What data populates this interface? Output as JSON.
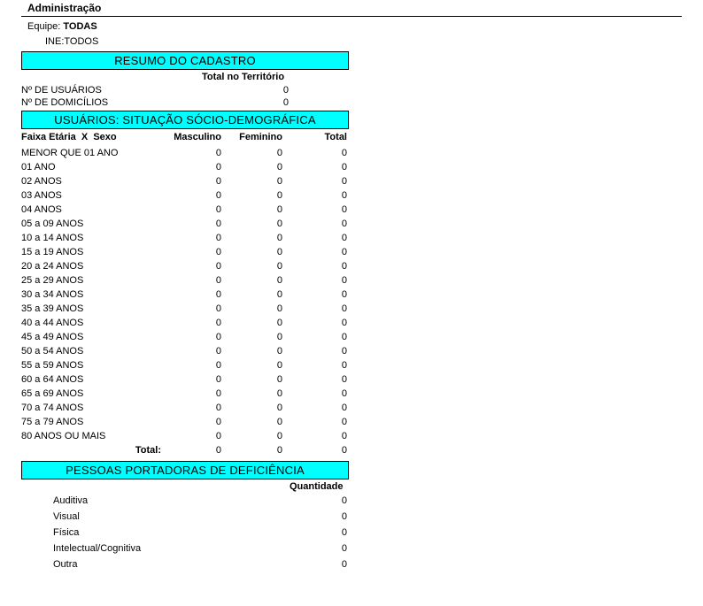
{
  "header": {
    "title": "Administração"
  },
  "filters": {
    "equipe_label": "Equipe:",
    "equipe_value": "TODAS",
    "ine_label": "INE:",
    "ine_value": "TODOS"
  },
  "resumo": {
    "title": "RESUMO DO CADASTRO",
    "column_header": "Total no Território",
    "rows": [
      {
        "label": "Nº DE USUÁRIOS",
        "value": "0"
      },
      {
        "label": "Nº DE DOMICÍLIOS",
        "value": "0"
      }
    ]
  },
  "usuarios": {
    "title": "USUÁRIOS: SITUAÇÃO SÓCIO-DEMOGRÁFICA",
    "headers": {
      "faixa": "Faixa Etária  X  Sexo",
      "masc": "Masculino",
      "fem": "Feminino",
      "total": "Total"
    },
    "rows": [
      {
        "label": "MENOR QUE 01 ANO",
        "m": "0",
        "f": "0",
        "t": "0"
      },
      {
        "label": "01 ANO",
        "m": "0",
        "f": "0",
        "t": "0"
      },
      {
        "label": "02 ANOS",
        "m": "0",
        "f": "0",
        "t": "0"
      },
      {
        "label": "03 ANOS",
        "m": "0",
        "f": "0",
        "t": "0"
      },
      {
        "label": "04 ANOS",
        "m": "0",
        "f": "0",
        "t": "0"
      },
      {
        "label": "05 a 09 ANOS",
        "m": "0",
        "f": "0",
        "t": "0"
      },
      {
        "label": "10 a 14 ANOS",
        "m": "0",
        "f": "0",
        "t": "0"
      },
      {
        "label": "15 a 19 ANOS",
        "m": "0",
        "f": "0",
        "t": "0"
      },
      {
        "label": "20 a 24 ANOS",
        "m": "0",
        "f": "0",
        "t": "0"
      },
      {
        "label": "25 a 29 ANOS",
        "m": "0",
        "f": "0",
        "t": "0"
      },
      {
        "label": "30 a 34 ANOS",
        "m": "0",
        "f": "0",
        "t": "0"
      },
      {
        "label": "35 a 39 ANOS",
        "m": "0",
        "f": "0",
        "t": "0"
      },
      {
        "label": "40 a 44 ANOS",
        "m": "0",
        "f": "0",
        "t": "0"
      },
      {
        "label": "45 a 49 ANOS",
        "m": "0",
        "f": "0",
        "t": "0"
      },
      {
        "label": "50 a 54 ANOS",
        "m": "0",
        "f": "0",
        "t": "0"
      },
      {
        "label": "55 a 59 ANOS",
        "m": "0",
        "f": "0",
        "t": "0"
      },
      {
        "label": "60 a 64 ANOS",
        "m": "0",
        "f": "0",
        "t": "0"
      },
      {
        "label": "65 a 69 ANOS",
        "m": "0",
        "f": "0",
        "t": "0"
      },
      {
        "label": "70 a 74 ANOS",
        "m": "0",
        "f": "0",
        "t": "0"
      },
      {
        "label": "75 a 79 ANOS",
        "m": "0",
        "f": "0",
        "t": "0"
      },
      {
        "label": "80 ANOS OU MAIS",
        "m": "0",
        "f": "0",
        "t": "0"
      }
    ],
    "total": {
      "label": "Total:",
      "m": "0",
      "f": "0",
      "t": "0"
    }
  },
  "deficiencia": {
    "title": "PESSOAS PORTADORAS DE DEFICIÊNCIA",
    "column_header": "Quantidade",
    "rows": [
      {
        "label": "Auditiva",
        "value": "0"
      },
      {
        "label": "Visual",
        "value": "0"
      },
      {
        "label": "Física",
        "value": "0"
      },
      {
        "label": "Intelectual/Cognitiva",
        "value": "0"
      },
      {
        "label": "Outra",
        "value": "0"
      }
    ]
  }
}
